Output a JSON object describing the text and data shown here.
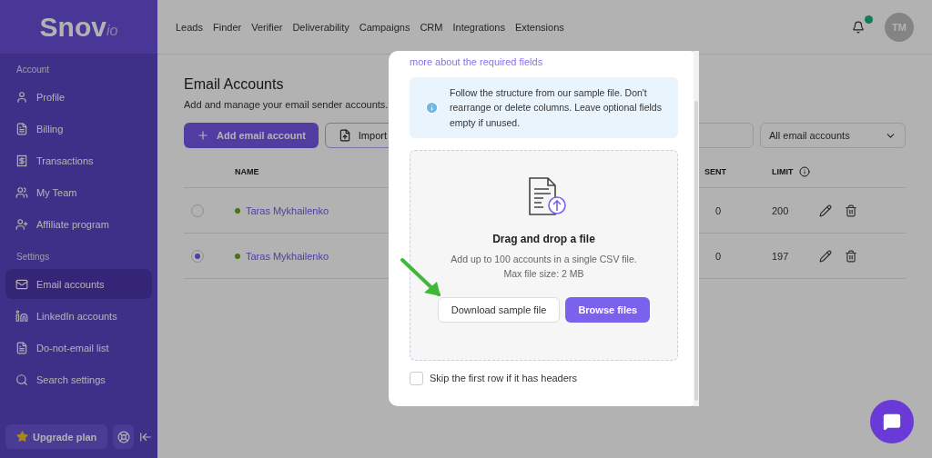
{
  "logo": {
    "main": "Snov",
    "suffix": "io"
  },
  "nav": [
    "Leads",
    "Finder",
    "Verifier",
    "Deliverability",
    "Campaigns",
    "CRM",
    "Integrations",
    "Extensions"
  ],
  "header": {
    "notification_dot": true,
    "avatar": "TM"
  },
  "sidebar": {
    "sections": [
      {
        "title": "Account",
        "items": [
          {
            "label": "Profile",
            "selected": false
          },
          {
            "label": "Billing",
            "selected": false
          },
          {
            "label": "Transactions",
            "selected": false
          },
          {
            "label": "My Team",
            "selected": false
          },
          {
            "label": "Affiliate program",
            "selected": false
          }
        ]
      },
      {
        "title": "Settings",
        "items": [
          {
            "label": "Email accounts",
            "selected": true
          },
          {
            "label": "LinkedIn accounts",
            "selected": false
          },
          {
            "label": "Do-not-email list",
            "selected": false
          },
          {
            "label": "Search settings",
            "selected": false
          }
        ]
      }
    ],
    "upgrade": "Upgrade plan"
  },
  "page": {
    "title": "Email Accounts",
    "subtitle": "Add and manage your email sender accounts.",
    "add_button": "Add email account",
    "import_button": "Import",
    "filter": "All email accounts"
  },
  "table": {
    "columns": [
      "NAME",
      "SENT",
      "LIMIT"
    ],
    "rows": [
      {
        "name": "Taras Mykhailenko",
        "selected": false,
        "online": true,
        "sent": "0",
        "limit": "200"
      },
      {
        "name": "Taras Mykhailenko",
        "selected": true,
        "online": true,
        "sent": "0",
        "limit": "197"
      }
    ]
  },
  "modal": {
    "link": "more about the required fields",
    "info": "Follow the structure from our sample file. Don't rearrange or delete columns. Leave optional fields empty if unused.",
    "drop_title": "Drag and drop a file",
    "drop_text": [
      "Add up to 100 accounts in a single CSV file.",
      "Max file size: 2 MB"
    ],
    "download_button": "Download sample file",
    "browse_button": "Browse files",
    "skip_header": {
      "label": "Skip the first row if it has headers",
      "checked": false
    }
  }
}
